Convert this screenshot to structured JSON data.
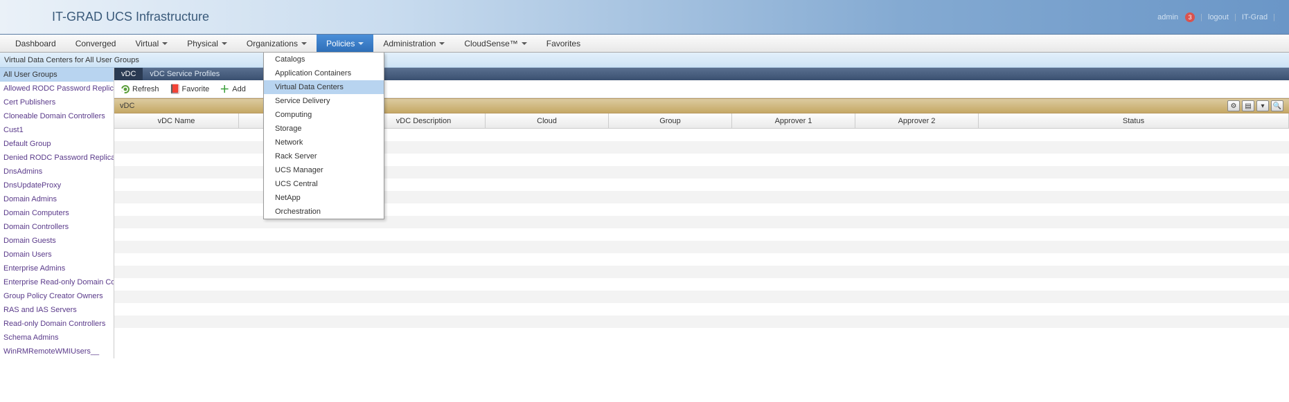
{
  "header": {
    "title": "IT-GRAD UCS Infrastructure",
    "user": "admin",
    "notif_count": "3",
    "logout": "logout",
    "tenant": "IT-Grad"
  },
  "menu": {
    "items": [
      {
        "label": "Dashboard",
        "caret": false
      },
      {
        "label": "Converged",
        "caret": false
      },
      {
        "label": "Virtual",
        "caret": true
      },
      {
        "label": "Physical",
        "caret": true
      },
      {
        "label": "Organizations",
        "caret": true
      },
      {
        "label": "Policies",
        "caret": true,
        "active": true
      },
      {
        "label": "Administration",
        "caret": true
      },
      {
        "label": "CloudSense™",
        "caret": true
      },
      {
        "label": "Favorites",
        "caret": false
      }
    ]
  },
  "dropdown": {
    "items": [
      "Catalogs",
      "Application Containers",
      "Virtual Data Centers",
      "Service Delivery",
      "Computing",
      "Storage",
      "Network",
      "Rack Server",
      "UCS Manager",
      "UCS Central",
      "NetApp",
      "Orchestration"
    ],
    "highlighted": "Virtual Data Centers"
  },
  "sub_header": "Virtual Data Centers for All User Groups",
  "sidebar": {
    "items": [
      "All User Groups",
      "Allowed RODC Password Replication",
      "Cert Publishers",
      "Cloneable Domain Controllers",
      "Cust1",
      "Default Group",
      "Denied RODC Password Replication",
      "DnsAdmins",
      "DnsUpdateProxy",
      "Domain Admins",
      "Domain Computers",
      "Domain Controllers",
      "Domain Guests",
      "Domain Users",
      "Enterprise Admins",
      "Enterprise Read-only Domain Con",
      "Group Policy Creator Owners",
      "RAS and IAS Servers",
      "Read-only Domain Controllers",
      "Schema Admins",
      "WinRMRemoteWMIUsers__"
    ],
    "selected": "All User Groups"
  },
  "tabs": [
    {
      "label": "vDC",
      "active": true
    },
    {
      "label": "vDC Service Profiles",
      "active": false
    }
  ],
  "toolbar": {
    "refresh": "Refresh",
    "favorite": "Favorite",
    "add": "Add"
  },
  "band": {
    "title": "vDC"
  },
  "columns": [
    "vDC Name",
    "",
    "vDC Description",
    "Cloud",
    "Group",
    "Approver 1",
    "Approver 2",
    "Status"
  ]
}
